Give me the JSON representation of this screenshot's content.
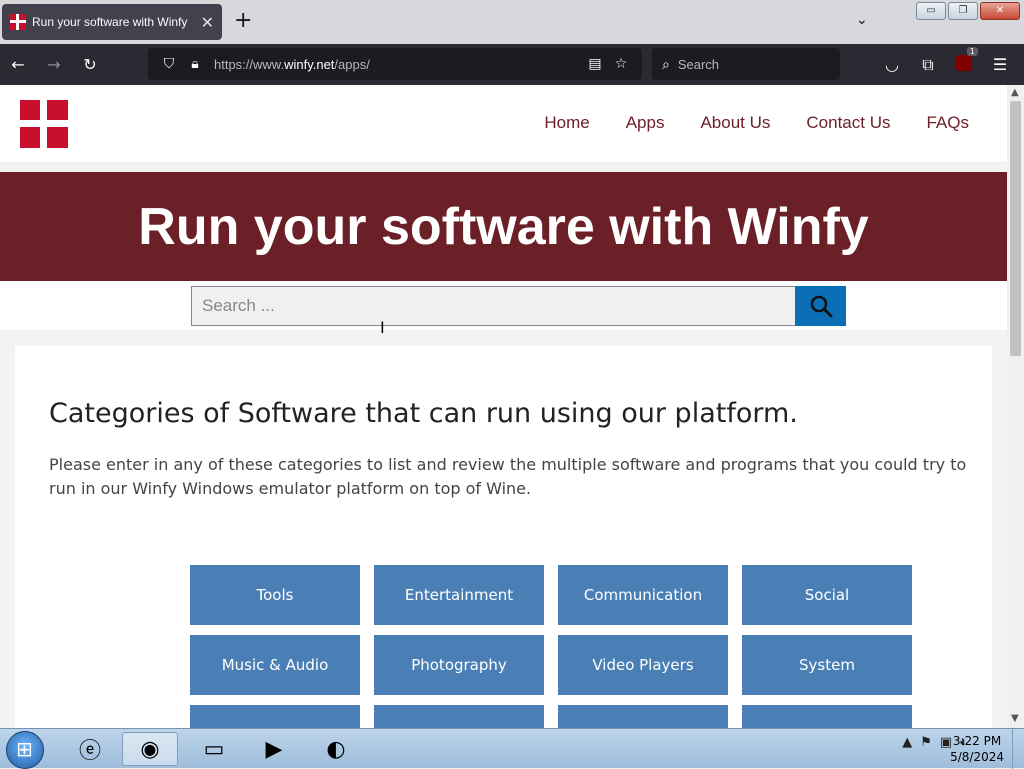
{
  "browser": {
    "tab_title": "Run your software with Winfy",
    "tab_close": "✕",
    "new_tab": "+",
    "tab_list": "⌄",
    "url_prefix": "https://www.",
    "url_host": "winfy.net",
    "url_path": "/apps/",
    "search_placeholder": "Search",
    "extension_badge": "1",
    "window_buttons": [
      "▭",
      "❐",
      "✕"
    ]
  },
  "site": {
    "nav": [
      "Home",
      "Apps",
      "About Us",
      "Contact Us",
      "FAQs"
    ],
    "hero_title": "Run your software with Winfy",
    "search_placeholder": "Search ...",
    "heading": "Categories of Software that can run using our platform.",
    "intro": "Please enter in any of these categories to list and review the multiple software and programs that you could try to run in our Winfy Windows emulator platform on top of Wine.",
    "categories": [
      "Tools",
      "Entertainment",
      "Communication",
      "Social",
      "Music & Audio",
      "Photography",
      "Video Players",
      "System",
      "",
      "",
      "",
      ""
    ]
  },
  "taskbar": {
    "time": "3:22 PM",
    "date": "5/8/2024"
  },
  "colors": {
    "brand": "#6b1f26",
    "accent": "#0b6fb8",
    "category_tile": "#4a7fb5",
    "logo": "#c8102e"
  }
}
